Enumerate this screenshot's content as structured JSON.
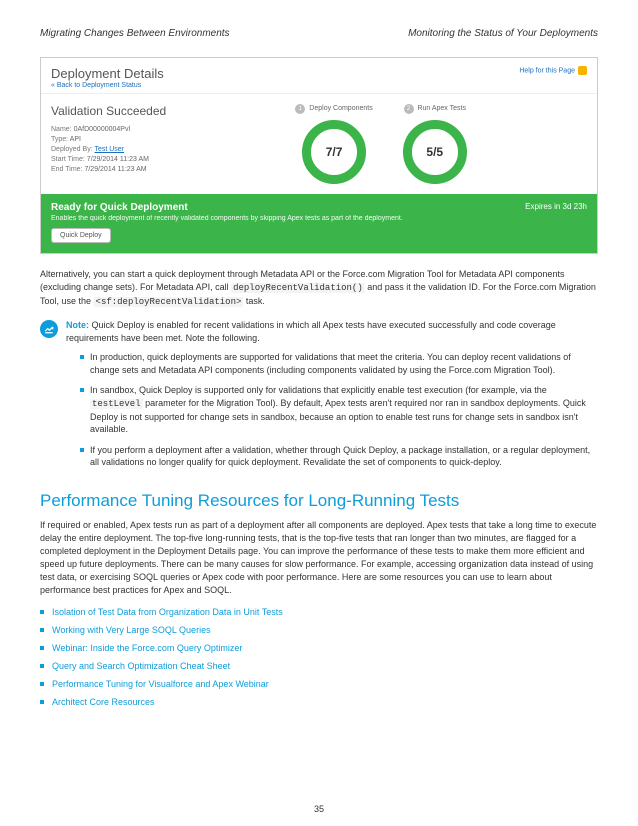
{
  "header": {
    "left": "Migrating Changes Between Environments",
    "right": "Monitoring the Status of Your Deployments"
  },
  "panel": {
    "title": "Deployment Details",
    "backLink": "« Back to Deployment Status",
    "helpText": "Help for this Page",
    "validationTitle": "Validation Succeeded",
    "meta": {
      "nameLabel": "Name:",
      "nameValue": "0AfD00000004Pvl",
      "typeLabel": "Type:",
      "typeValue": "API",
      "deployedByLabel": "Deployed By:",
      "deployedByValue": "Test User",
      "startLabel": "Start Time:",
      "startValue": "7/29/2014 11:23 AM",
      "endLabel": "End Time:",
      "endValue": "7/29/2014 11:23 AM"
    },
    "steps": {
      "s1num": "1",
      "s1label": "Deploy Components",
      "s1value": "7/7",
      "s2num": "2",
      "s2label": "Run Apex Tests",
      "s2value": "5/5"
    },
    "band": {
      "title": "Ready for Quick Deployment",
      "subtitle": "Enables the quick deployment of recently validated components by skipping Apex tests as part of the deployment.",
      "expires": "Expires in 3d 23h",
      "button": "Quick Deploy"
    }
  },
  "para1a": "Alternatively, you can start a quick deployment through Metadata API or the Force.com Migration Tool for Metadata API components (excluding change sets). For Metadata API, call ",
  "code1": "deployRecentValidation()",
  "para1b": " and pass it the validation ID. For the Force.com Migration Tool, use the ",
  "code2": "<sf:deployRecentValidation>",
  "para1c": " task.",
  "note": {
    "label": "Note:",
    "intro": " Quick Deploy is enabled for recent validations in which all Apex tests have executed successfully and code coverage requirements have been met. Note the following.",
    "b1": "In production, quick deployments are supported for validations that meet the criteria. You can deploy recent validations of change sets and Metadata API components (including components validated by using the Force.com Migration Tool).",
    "b2a": "In sandbox, Quick Deploy is supported only for validations that explicitly enable test execution (for example, via the ",
    "b2code": "testLevel",
    "b2b": " parameter for the Migration Tool). By default, Apex tests aren't required nor ran in sandbox deployments. Quick Deploy is not supported for change sets in sandbox, because an option to enable test runs for change sets in sandbox isn't available.",
    "b3": "If you perform a deployment after a validation, whether through Quick Deploy, a package installation, or a regular deployment, all validations no longer qualify for quick deployment. Revalidate the set of components to quick-deploy."
  },
  "section": {
    "title": "Performance Tuning Resources for Long-Running Tests",
    "para": "If required or enabled, Apex tests run as part of a deployment after all components are deployed. Apex tests that take a long time to execute delay the entire deployment. The top-five long-running tests, that is the top-five tests that ran longer than two minutes, are flagged for a completed deployment in the Deployment Details page. You can improve the performance of these tests to make them more efficient and speed up future deployments. There can be many causes for slow performance. For example, accessing organization data instead of using test data, or exercising SOQL queries or Apex code with poor performance. Here are some resources you can use to learn about performance best practices for Apex and SOQL."
  },
  "links": [
    "Isolation of Test Data from Organization Data in Unit Tests",
    "Working with Very Large SOQL Queries",
    "Webinar: Inside the Force.com Query Optimizer",
    "Query and Search Optimization Cheat Sheet",
    "Performance Tuning for Visualforce and Apex Webinar",
    "Architect Core Resources"
  ],
  "pageNumber": "35"
}
